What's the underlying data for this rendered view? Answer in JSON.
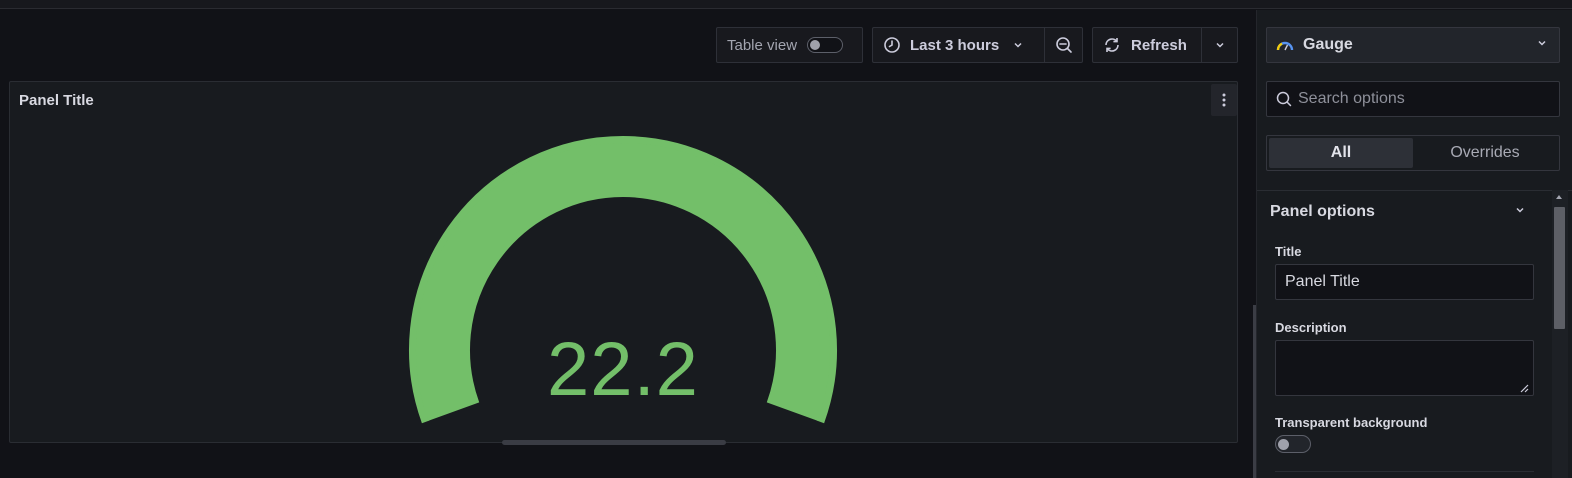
{
  "toolbar": {
    "table_view_label": "Table view",
    "table_view_on": false,
    "time_range_label": "Last 3 hours",
    "refresh_label": "Refresh"
  },
  "panel": {
    "title": "Panel Title",
    "gauge": {
      "value": "22.2",
      "fill_fraction": 1.0,
      "color": "#73bf69"
    }
  },
  "options_pane": {
    "visualization": "Gauge",
    "search_placeholder": "Search options",
    "tabs": [
      {
        "label": "All",
        "active": true
      },
      {
        "label": "Overrides",
        "active": false
      }
    ],
    "section_title": "Panel options",
    "fields": {
      "title_label": "Title",
      "title_value": "Panel Title",
      "description_label": "Description",
      "description_value": "",
      "transparent_label": "Transparent background",
      "transparent_on": false
    }
  },
  "icons": {
    "time": "clock-icon",
    "zoom": "zoom-out-icon",
    "refresh": "refresh-icon",
    "viz": "gauge-icon",
    "search": "search-icon"
  },
  "colors": {
    "background": "#111217",
    "panel": "#181b1f",
    "gauge_green": "#73bf69"
  }
}
